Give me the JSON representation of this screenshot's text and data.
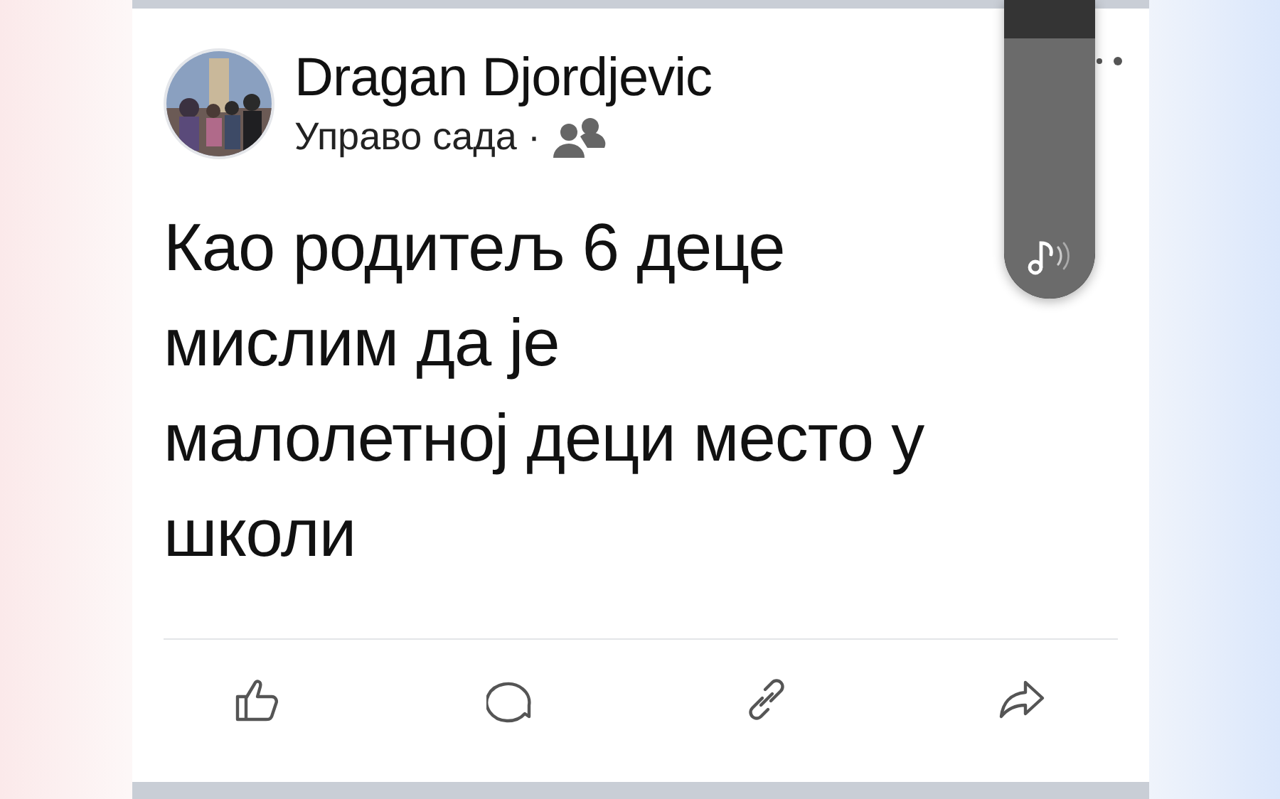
{
  "post": {
    "author": "Dragan Djordjevic",
    "time": "Управо сада ·",
    "text": "Као родитељ 6 деце\nмислим да је\nмалолетној деци место у\nшколи"
  },
  "volume_slider": {
    "level": 0.87
  }
}
